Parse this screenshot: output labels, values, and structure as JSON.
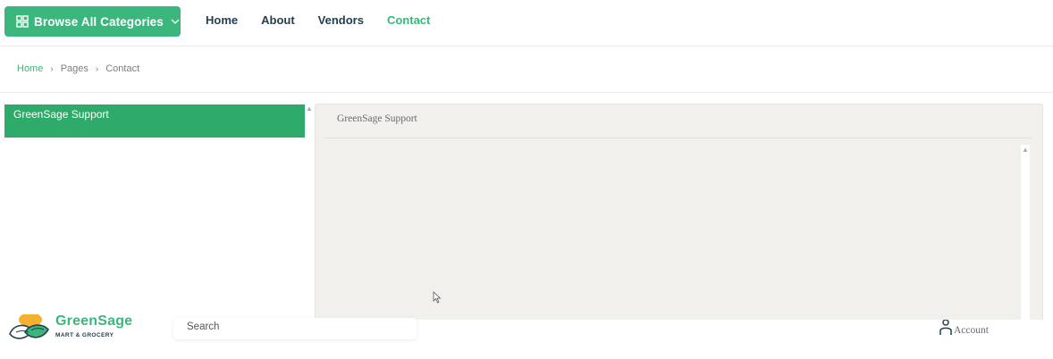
{
  "topnav": {
    "browse_label": "Browse All Categories",
    "links": [
      {
        "label": "Home",
        "active": false
      },
      {
        "label": "About",
        "active": false
      },
      {
        "label": "Vendors",
        "active": false
      },
      {
        "label": "Contact",
        "active": true
      }
    ]
  },
  "breadcrumb": {
    "items": [
      "Home",
      "Pages",
      "Contact"
    ],
    "separator": "›"
  },
  "support": {
    "left_title": "GreenSage Support",
    "panel_title": "GreenSage Support"
  },
  "header": {
    "brand_name": "GreenSage",
    "brand_sub": "MART & GROCERY",
    "search_placeholder": "Search",
    "account_label": "Account"
  },
  "colors": {
    "brand_green": "#3bb77e",
    "support_green": "#2eaa6a",
    "panel_bg": "#f1f0ec",
    "text_dark": "#253d4e"
  }
}
